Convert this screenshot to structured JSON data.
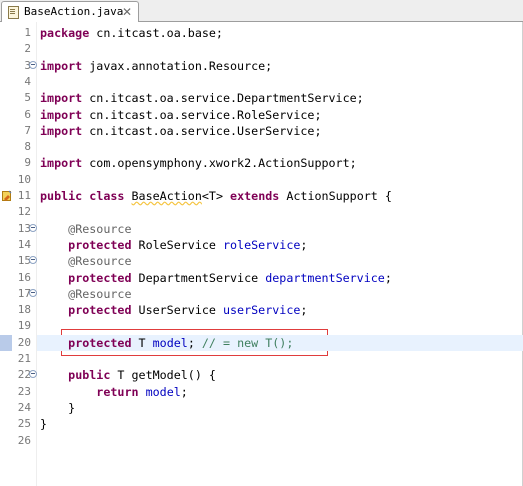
{
  "tab": {
    "title": "BaseAction.java",
    "close_glyph": "✕"
  },
  "lines": [
    {
      "num": "1",
      "parts": [
        {
          "t": "package",
          "c": "kw"
        },
        {
          "t": " cn.itcast.oa.base;"
        }
      ]
    },
    {
      "num": "2",
      "parts": []
    },
    {
      "num": "3",
      "fold": true,
      "parts": [
        {
          "t": "import",
          "c": "kw"
        },
        {
          "t": " javax.annotation.Resource;"
        }
      ]
    },
    {
      "num": "4",
      "parts": []
    },
    {
      "num": "5",
      "parts": [
        {
          "t": "import",
          "c": "kw"
        },
        {
          "t": " cn.itcast.oa.service.DepartmentService;"
        }
      ]
    },
    {
      "num": "6",
      "parts": [
        {
          "t": "import",
          "c": "kw"
        },
        {
          "t": " cn.itcast.oa.service.RoleService;"
        }
      ]
    },
    {
      "num": "7",
      "parts": [
        {
          "t": "import",
          "c": "kw"
        },
        {
          "t": " cn.itcast.oa.service.UserService;"
        }
      ]
    },
    {
      "num": "8",
      "parts": []
    },
    {
      "num": "9",
      "parts": [
        {
          "t": "import",
          "c": "kw"
        },
        {
          "t": " com.opensymphony.xwork2.ActionSupport;"
        }
      ]
    },
    {
      "num": "10",
      "parts": []
    },
    {
      "num": "11",
      "override": true,
      "parts": [
        {
          "t": "public",
          "c": "kw"
        },
        {
          "t": " "
        },
        {
          "t": "class",
          "c": "kw"
        },
        {
          "t": " "
        },
        {
          "t": "BaseAction",
          "c": "typeref"
        },
        {
          "t": "<T> "
        },
        {
          "t": "extends",
          "c": "kw"
        },
        {
          "t": " ActionSupport {"
        }
      ]
    },
    {
      "num": "12",
      "parts": []
    },
    {
      "num": "13",
      "fold": true,
      "parts": [
        {
          "t": "    "
        },
        {
          "t": "@Resource",
          "c": "ann"
        }
      ]
    },
    {
      "num": "14",
      "parts": [
        {
          "t": "    "
        },
        {
          "t": "protected",
          "c": "kw"
        },
        {
          "t": " RoleService "
        },
        {
          "t": "roleService",
          "c": "fld"
        },
        {
          "t": ";"
        }
      ]
    },
    {
      "num": "15",
      "fold": true,
      "parts": [
        {
          "t": "    "
        },
        {
          "t": "@Resource",
          "c": "ann"
        }
      ]
    },
    {
      "num": "16",
      "parts": [
        {
          "t": "    "
        },
        {
          "t": "protected",
          "c": "kw"
        },
        {
          "t": " DepartmentService "
        },
        {
          "t": "departmentService",
          "c": "fld"
        },
        {
          "t": ";"
        }
      ]
    },
    {
      "num": "17",
      "fold": true,
      "parts": [
        {
          "t": "    "
        },
        {
          "t": "@Resource",
          "c": "ann"
        }
      ]
    },
    {
      "num": "18",
      "parts": [
        {
          "t": "    "
        },
        {
          "t": "protected",
          "c": "kw"
        },
        {
          "t": " UserService "
        },
        {
          "t": "userService",
          "c": "fld"
        },
        {
          "t": ";"
        }
      ]
    },
    {
      "num": "19",
      "parts": []
    },
    {
      "num": "20",
      "current": true,
      "parts": [
        {
          "t": "    "
        },
        {
          "t": "protected",
          "c": "kw"
        },
        {
          "t": " T "
        },
        {
          "t": "model",
          "c": "fld"
        },
        {
          "t": "; "
        },
        {
          "t": "// = new T();",
          "c": "cmt"
        }
      ]
    },
    {
      "num": "21",
      "parts": []
    },
    {
      "num": "22",
      "fold": true,
      "parts": [
        {
          "t": "    "
        },
        {
          "t": "public",
          "c": "kw"
        },
        {
          "t": " T getModel() {"
        }
      ]
    },
    {
      "num": "23",
      "parts": [
        {
          "t": "        "
        },
        {
          "t": "return",
          "c": "kw"
        },
        {
          "t": " "
        },
        {
          "t": "model",
          "c": "fld"
        },
        {
          "t": ";"
        }
      ]
    },
    {
      "num": "24",
      "parts": [
        {
          "t": "    }"
        }
      ]
    },
    {
      "num": "25",
      "parts": [
        {
          "t": "}"
        }
      ]
    },
    {
      "num": "26",
      "parts": []
    }
  ],
  "colors": {
    "keyword": "#7f0055",
    "field": "#0000c0",
    "annotation": "#646464",
    "comment": "#3f7f5f",
    "highlight_box": "#e03c3c",
    "current_line": "#e8f2fe"
  }
}
